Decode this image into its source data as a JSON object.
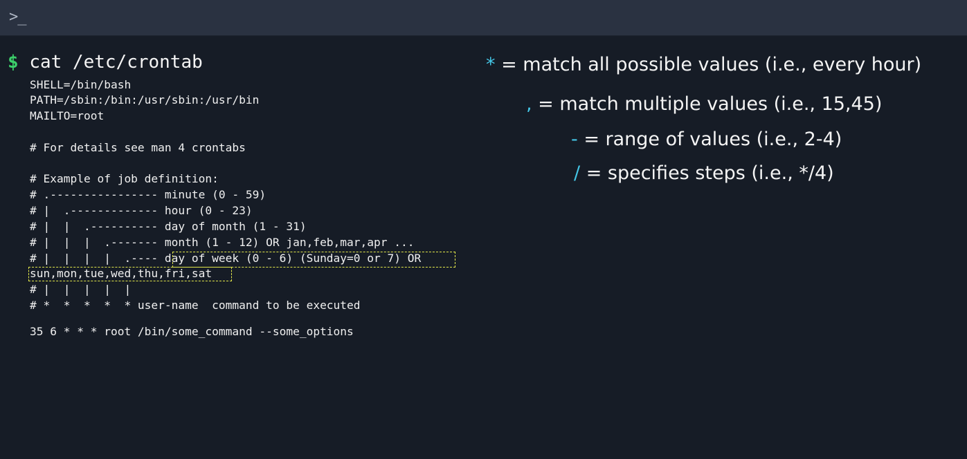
{
  "titlebar": {
    "icon": "terminal-prompt-icon",
    "glyph": ">_"
  },
  "terminal": {
    "prompt": "$",
    "command": "cat /etc/crontab",
    "lines": [
      "SHELL=/bin/bash",
      "PATH=/sbin:/bin:/usr/sbin:/usr/bin",
      "MAILTO=root",
      "# For details see man 4 crontabs",
      "# Example of job definition:",
      "# .---------------- minute (0 - 59)",
      "# |  .------------- hour (0 - 23)",
      "# |  |  .---------- day of month (1 - 31)",
      "# |  |  |  .------- month (1 - 12) OR jan,feb,mar,apr ...",
      "# |  |  |  |  .---- day of week (0 - 6) (Sunday=0 or 7) OR",
      "sun,mon,tue,wed,thu,fri,sat",
      "# |  |  |  |  |",
      "# *  *  *  *  * user-name  command to be executed",
      "35 6 * * * root /bin/some_command --some_options"
    ]
  },
  "legend": [
    {
      "symbol": "*",
      "text": " = match all possible values (i.e., every hour)"
    },
    {
      "symbol": ",",
      "text": " = match multiple values (i.e., 15,45)"
    },
    {
      "symbol": "-",
      "text": " = range of values (i.e., 2-4)"
    },
    {
      "symbol": "/",
      "text": " = specifies steps (i.e., */4)"
    }
  ],
  "colors": {
    "background": "#161c26",
    "titlebar": "#2a3241",
    "prompt": "#3ccf6a",
    "symbol": "#44c6e6",
    "highlight": "#e3e84a"
  }
}
